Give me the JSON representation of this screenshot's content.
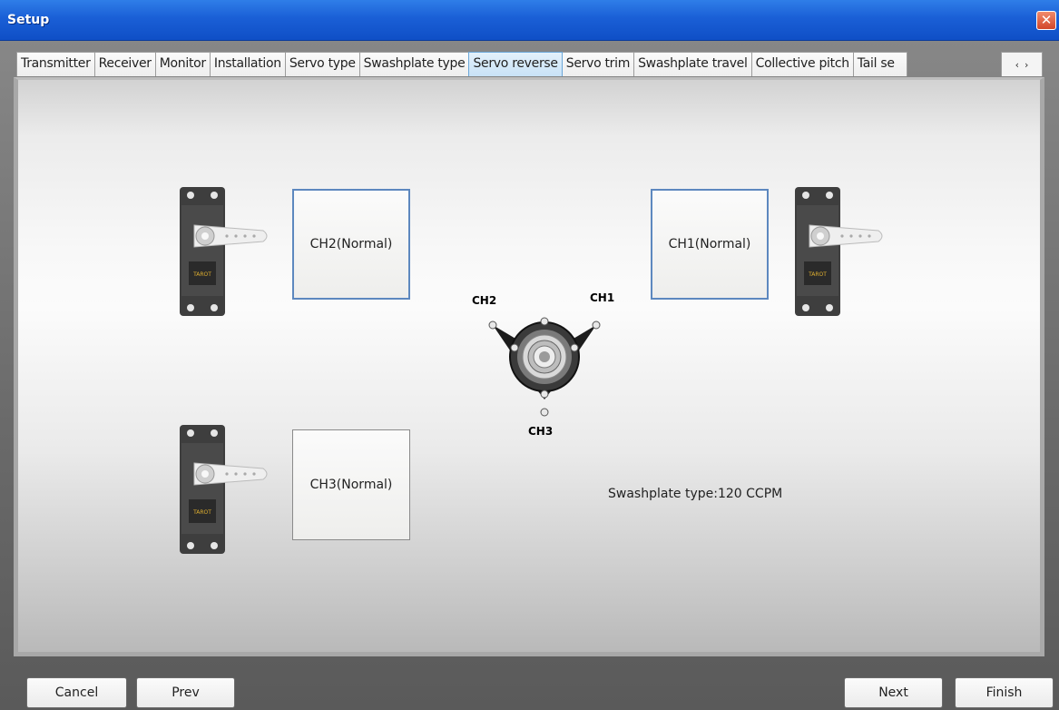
{
  "window": {
    "title": "Setup",
    "close_glyph": "✕"
  },
  "tabs": [
    {
      "label": "Transmitter"
    },
    {
      "label": "Receiver"
    },
    {
      "label": "Monitor"
    },
    {
      "label": "Installation"
    },
    {
      "label": "Servo type"
    },
    {
      "label": "Swashplate type"
    },
    {
      "label": "Servo reverse",
      "active": true
    },
    {
      "label": "Servo trim"
    },
    {
      "label": "Swashplate travel"
    },
    {
      "label": "Collective pitch"
    },
    {
      "label": "Tail se"
    }
  ],
  "tab_scroll": {
    "left": "‹",
    "right": "›"
  },
  "servo_reverse": {
    "ch2": "CH2(Normal)",
    "ch1": "CH1(Normal)",
    "ch3": "CH3(Normal)",
    "swash_labels": {
      "ch1": "CH1",
      "ch2": "CH2",
      "ch3": "CH3"
    },
    "swashplate_type": "Swashplate type:120 CCPM",
    "servo_brand": "TAROT"
  },
  "buttons": {
    "cancel": "Cancel",
    "prev": "Prev",
    "next": "Next",
    "finish": "Finish"
  },
  "colors": {
    "titlebar": "#1a5fd6",
    "active_tab": "#c8e2f7",
    "selected_box_border": "#5d88bf"
  }
}
